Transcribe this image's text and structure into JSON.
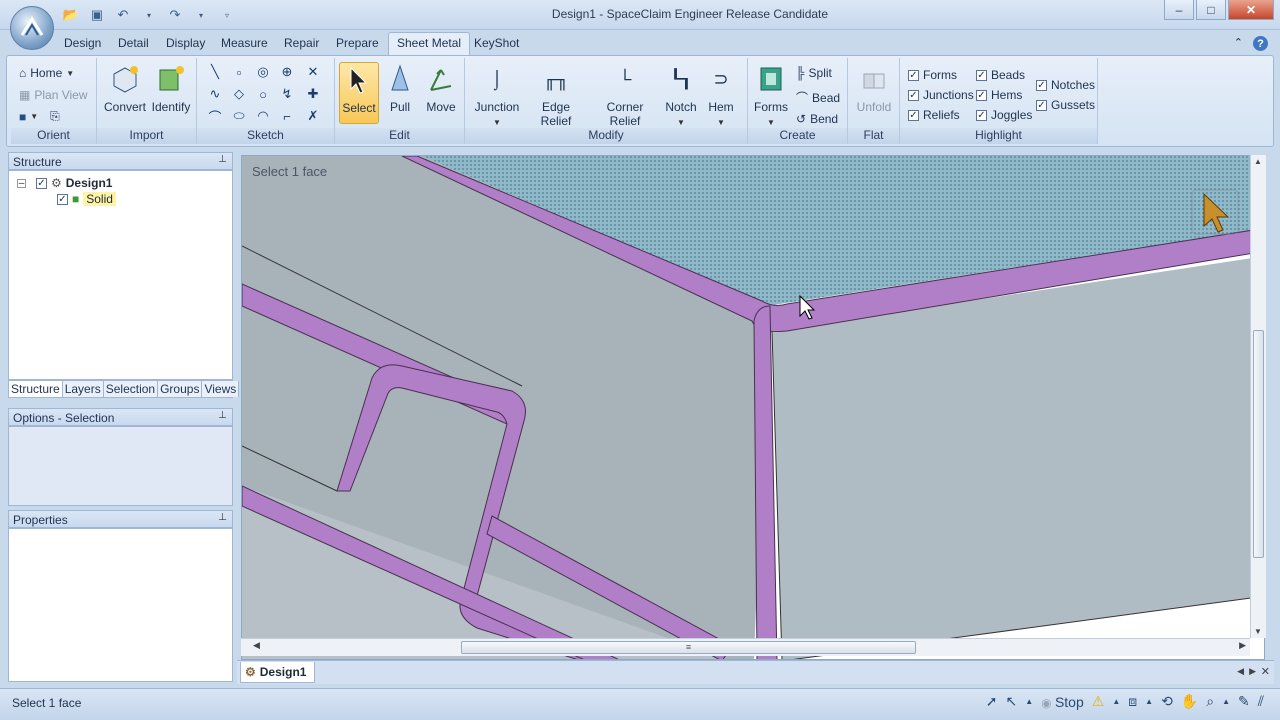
{
  "window": {
    "title": "Design1 - SpaceClaim Engineer Release Candidate"
  },
  "tabs": [
    "Design",
    "Detail",
    "Display",
    "Measure",
    "Repair",
    "Prepare",
    "Sheet Metal",
    "KeyShot"
  ],
  "active_tab": "Sheet Metal",
  "ribbon": {
    "orient": {
      "label": "Orient",
      "home": "Home",
      "plan_view": "Plan View"
    },
    "import": {
      "label": "Import",
      "convert": "Convert",
      "identify": "Identify"
    },
    "sketch": {
      "label": "Sketch"
    },
    "edit": {
      "label": "Edit",
      "select": "Select",
      "pull": "Pull",
      "move": "Move"
    },
    "modify": {
      "label": "Modify",
      "junction": "Junction",
      "edge_relief": "Edge Relief",
      "corner_relief": "Corner Relief",
      "notch": "Notch",
      "hem": "Hem"
    },
    "create": {
      "label": "Create",
      "forms": "Forms",
      "split": "Split",
      "bead": "Bead",
      "bend": "Bend"
    },
    "flat": {
      "label": "Flat",
      "unfold": "Unfold"
    },
    "highlight": {
      "label": "Highlight",
      "items": [
        {
          "label": "Forms",
          "checked": true
        },
        {
          "label": "Junctions",
          "checked": true
        },
        {
          "label": "Reliefs",
          "checked": true
        },
        {
          "label": "Beads",
          "checked": true
        },
        {
          "label": "Hems",
          "checked": true
        },
        {
          "label": "Joggles",
          "checked": true
        },
        {
          "label": "Notches",
          "checked": true
        },
        {
          "label": "Gussets",
          "checked": true
        }
      ]
    }
  },
  "structure": {
    "title": "Structure",
    "tree": [
      {
        "label": "Design1"
      },
      {
        "label": "Solid"
      }
    ],
    "panel_tabs": [
      "Structure",
      "Layers",
      "Selection",
      "Groups",
      "Views"
    ]
  },
  "options": {
    "title": "Options - Selection"
  },
  "properties": {
    "title": "Properties"
  },
  "viewport": {
    "hint": "Select 1 face"
  },
  "doc_tab": "Design1",
  "status": {
    "text": "Select 1 face",
    "stop": "Stop"
  },
  "colors": {
    "bend_highlight": "#b07fc7",
    "panel_gray": "#a8b3bb",
    "ribbon": "#dce7f5"
  }
}
